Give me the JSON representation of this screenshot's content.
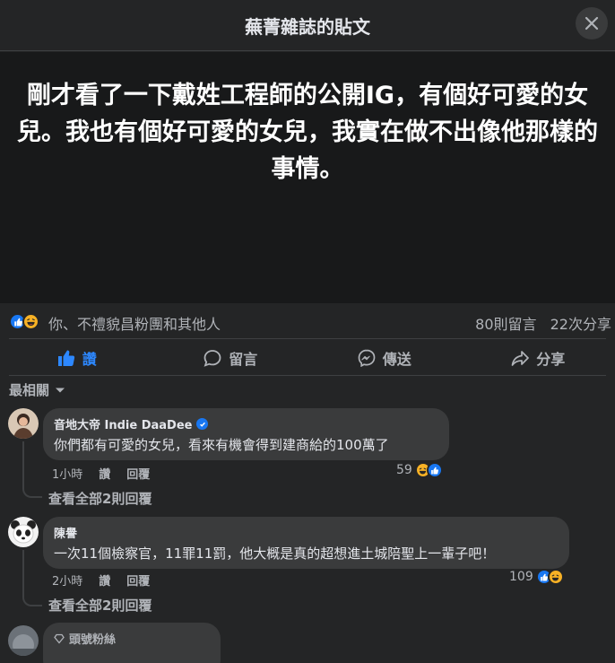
{
  "header": {
    "title": "蕪菁雜誌的貼文"
  },
  "post": {
    "text": "剛才看了一下戴姓工程師的公開IG，有個好可愛的女兒。我也有個好可愛的女兒，我實在做不出像他那樣的事情。"
  },
  "reactions": {
    "icons": [
      "like-icon",
      "haha-icon"
    ],
    "names": "你、不禮貌昌粉團和其他人",
    "comment_count": "80則留言",
    "share_count": "22次分享"
  },
  "actions": [
    {
      "label": "讚",
      "icon": "thumbs-up-icon",
      "active": true
    },
    {
      "label": "留言",
      "icon": "comment-icon"
    },
    {
      "label": "傳送",
      "icon": "messenger-icon"
    },
    {
      "label": "分享",
      "icon": "share-icon"
    }
  ],
  "sort": {
    "label": "最相關"
  },
  "comments": [
    {
      "name": "音地大帝 Indie DaaDee",
      "verified": true,
      "text": "你們都有可愛的女兒，看來有機會得到建商給的100萬了",
      "time": "1小時",
      "like": "讚",
      "reply": "回覆",
      "reaction_count": "59",
      "view_replies": "查看全部2則回覆"
    },
    {
      "name": "陳譽",
      "text": "一次11個檢察官，11罪11罰，他大概是真的超想進土城陪聖上一輩子吧！",
      "time": "2小時",
      "like": "讚",
      "reply": "回覆",
      "reaction_count": "109",
      "view_replies": "查看全部2則回覆"
    },
    {
      "badge": "頭號粉絲",
      "name": ""
    }
  ],
  "colors": {
    "background": "#242526",
    "post_bg": "#18191a",
    "bubble": "#3a3b3c",
    "accent": "#2d88ff",
    "text": "#e4e6eb",
    "muted": "#b0b3b8"
  }
}
